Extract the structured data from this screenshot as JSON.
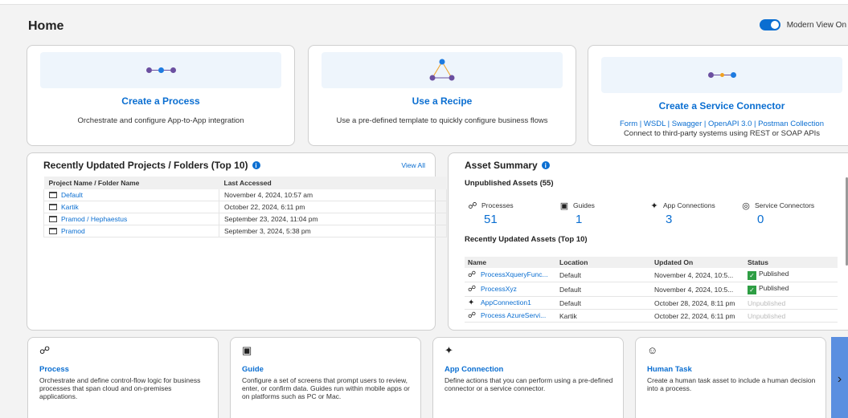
{
  "page": {
    "title": "Home"
  },
  "toggle": {
    "label": "Modern View On",
    "on": true
  },
  "hero_cards": [
    {
      "title": "Create a Process",
      "description": "Orchestrate and configure App-to-App integration"
    },
    {
      "title": "Use a Recipe",
      "description": "Use a pre-defined template to quickly configure business flows"
    },
    {
      "title": "Create a Service Connector",
      "links": "Form | WSDL | Swagger | OpenAPI 3.0 | Postman Collection",
      "description": "Connect to third-party systems using REST or SOAP APIs"
    }
  ],
  "projects": {
    "title": "Recently Updated Projects / Folders (Top 10)",
    "view_all": "View All",
    "columns": [
      "Project Name / Folder Name",
      "Last Accessed"
    ],
    "rows": [
      {
        "name": "Default",
        "accessed": "November 4, 2024, 10:57 am"
      },
      {
        "name": "Kartik",
        "accessed": "October 22, 2024, 6:11 pm"
      },
      {
        "name": "Pramod / Hephaestus",
        "accessed": "September 23, 2024, 11:04 pm"
      },
      {
        "name": "Pramod",
        "accessed": "September 3, 2024, 5:38 pm"
      }
    ]
  },
  "assets": {
    "title": "Asset Summary",
    "unpublished_heading": "Unpublished Assets (55)",
    "stats": [
      {
        "label": "Processes",
        "value": "51",
        "icon": "process-icon"
      },
      {
        "label": "Guides",
        "value": "1",
        "icon": "guide-icon"
      },
      {
        "label": "App Connections",
        "value": "3",
        "icon": "app-connection-icon"
      },
      {
        "label": "Service Connectors",
        "value": "0",
        "icon": "service-connector-icon"
      }
    ],
    "recent_heading": "Recently Updated Assets (Top 10)",
    "columns": [
      "Name",
      "Location",
      "Updated On",
      "Status"
    ],
    "rows": [
      {
        "name": "ProcessXqueryFunc...",
        "location": "Default",
        "updated": "November 4, 2024, 10:5...",
        "status": "Published",
        "icon": "process-icon"
      },
      {
        "name": "ProcessXyz",
        "location": "Default",
        "updated": "November 4, 2024, 10:5...",
        "status": "Published",
        "icon": "process-icon"
      },
      {
        "name": "AppConnection1",
        "location": "Default",
        "updated": "October 28, 2024, 8:11 pm",
        "status": "Unpublished",
        "icon": "app-connection-icon"
      },
      {
        "name": "Process AzureServi...",
        "location": "Kartik",
        "updated": "October 22, 2024, 6:11 pm",
        "status": "Unpublished",
        "icon": "process-icon"
      }
    ]
  },
  "bottom_cards": [
    {
      "title": "Process",
      "icon": "process-icon",
      "description": "Orchestrate and define control-flow logic for business processes that span cloud and on-premises applications."
    },
    {
      "title": "Guide",
      "icon": "guide-icon",
      "description": "Configure a set of screens that prompt users to review, enter, or confirm data. Guides run within mobile apps or on platforms such as PC or Mac."
    },
    {
      "title": "App Connection",
      "icon": "app-connection-icon",
      "description": "Define actions that you can perform using a pre-defined connector or a service connector."
    },
    {
      "title": "Human Task",
      "icon": "human-task-icon",
      "description": "Create a human task asset to include a human decision into a process."
    }
  ],
  "colors": {
    "accent": "#0a6ed1",
    "published": "#2e9e44",
    "dot_purple": "#6b4fa0",
    "dot_blue": "#1e7be0",
    "dot_orange": "#f0a020"
  }
}
